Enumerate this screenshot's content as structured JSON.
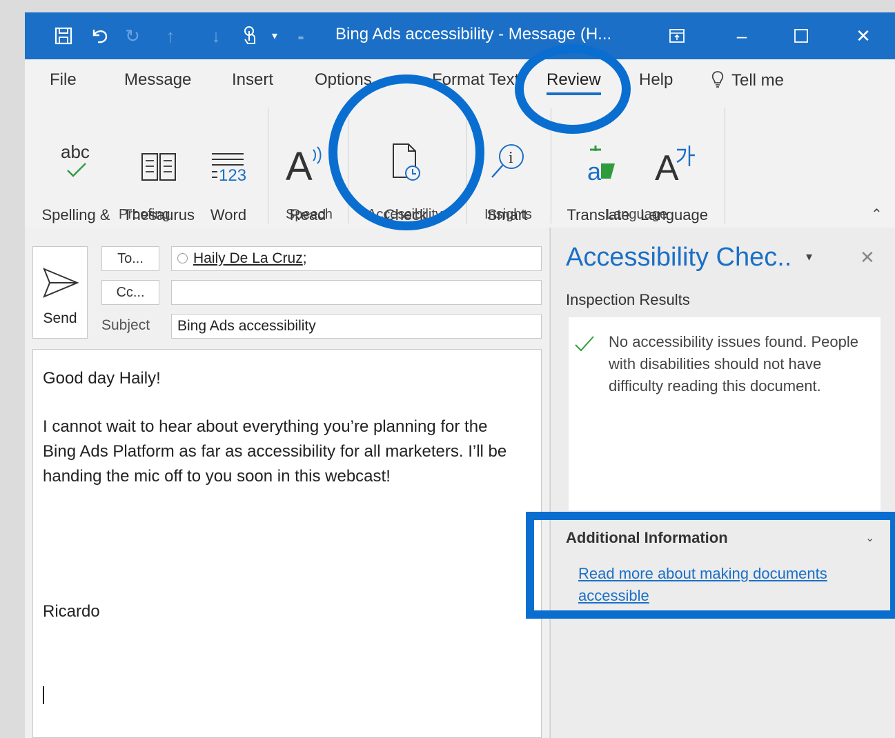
{
  "window": {
    "title": "Bing Ads accessibility - Message (H...",
    "accent": "#1b6fc6",
    "highlight": "#0a6ed1"
  },
  "menu": {
    "tabs": [
      {
        "label": "File"
      },
      {
        "label": "Message"
      },
      {
        "label": "Insert"
      },
      {
        "label": "Options"
      },
      {
        "label": "Format Text"
      },
      {
        "label": "Review"
      },
      {
        "label": "Help"
      }
    ],
    "active": "Review",
    "tell_me": "Tell me"
  },
  "ribbon": {
    "buttons": {
      "spelling": "Spelling &\nGrammar",
      "spelling_icon_text": "abc",
      "thesaurus": "Thesaurus",
      "word_count": "Word\nCount",
      "word_count_icon_text": "123",
      "read_aloud": "Read\nAloud",
      "check_accessibility": "Check\nAccessibility",
      "smart_lookup": "Smart\nLookup",
      "translate": "Translate",
      "language": "Language"
    },
    "groups": {
      "proofing": "Proofing",
      "speech": "Speech",
      "accessibility": "Accessibility",
      "insights": "Insights",
      "language": "Language"
    }
  },
  "compose": {
    "send": "Send",
    "to_button": "To...",
    "cc_button": "Cc...",
    "to_value": "Haily De La Cruz",
    "to_suffix": ";",
    "cc_value": "",
    "subject_label": "Subject",
    "subject_value": "Bing Ads accessibility",
    "body": {
      "greeting": "Good day Haily!",
      "paragraph": "I cannot wait to hear about everything you’re planning for the Bing Ads Platform as far as accessibility for all marketers. I’ll be handing the mic off to you soon in this webcast!",
      "signature": "Ricardo"
    }
  },
  "pane": {
    "title": "Accessibility Chec..",
    "inspection_label": "Inspection Results",
    "result": "No accessibility issues found. People with disabilities should not have difficulty reading this document.",
    "additional_label": "Additional Information",
    "link": "Read more about making documents accessible"
  }
}
